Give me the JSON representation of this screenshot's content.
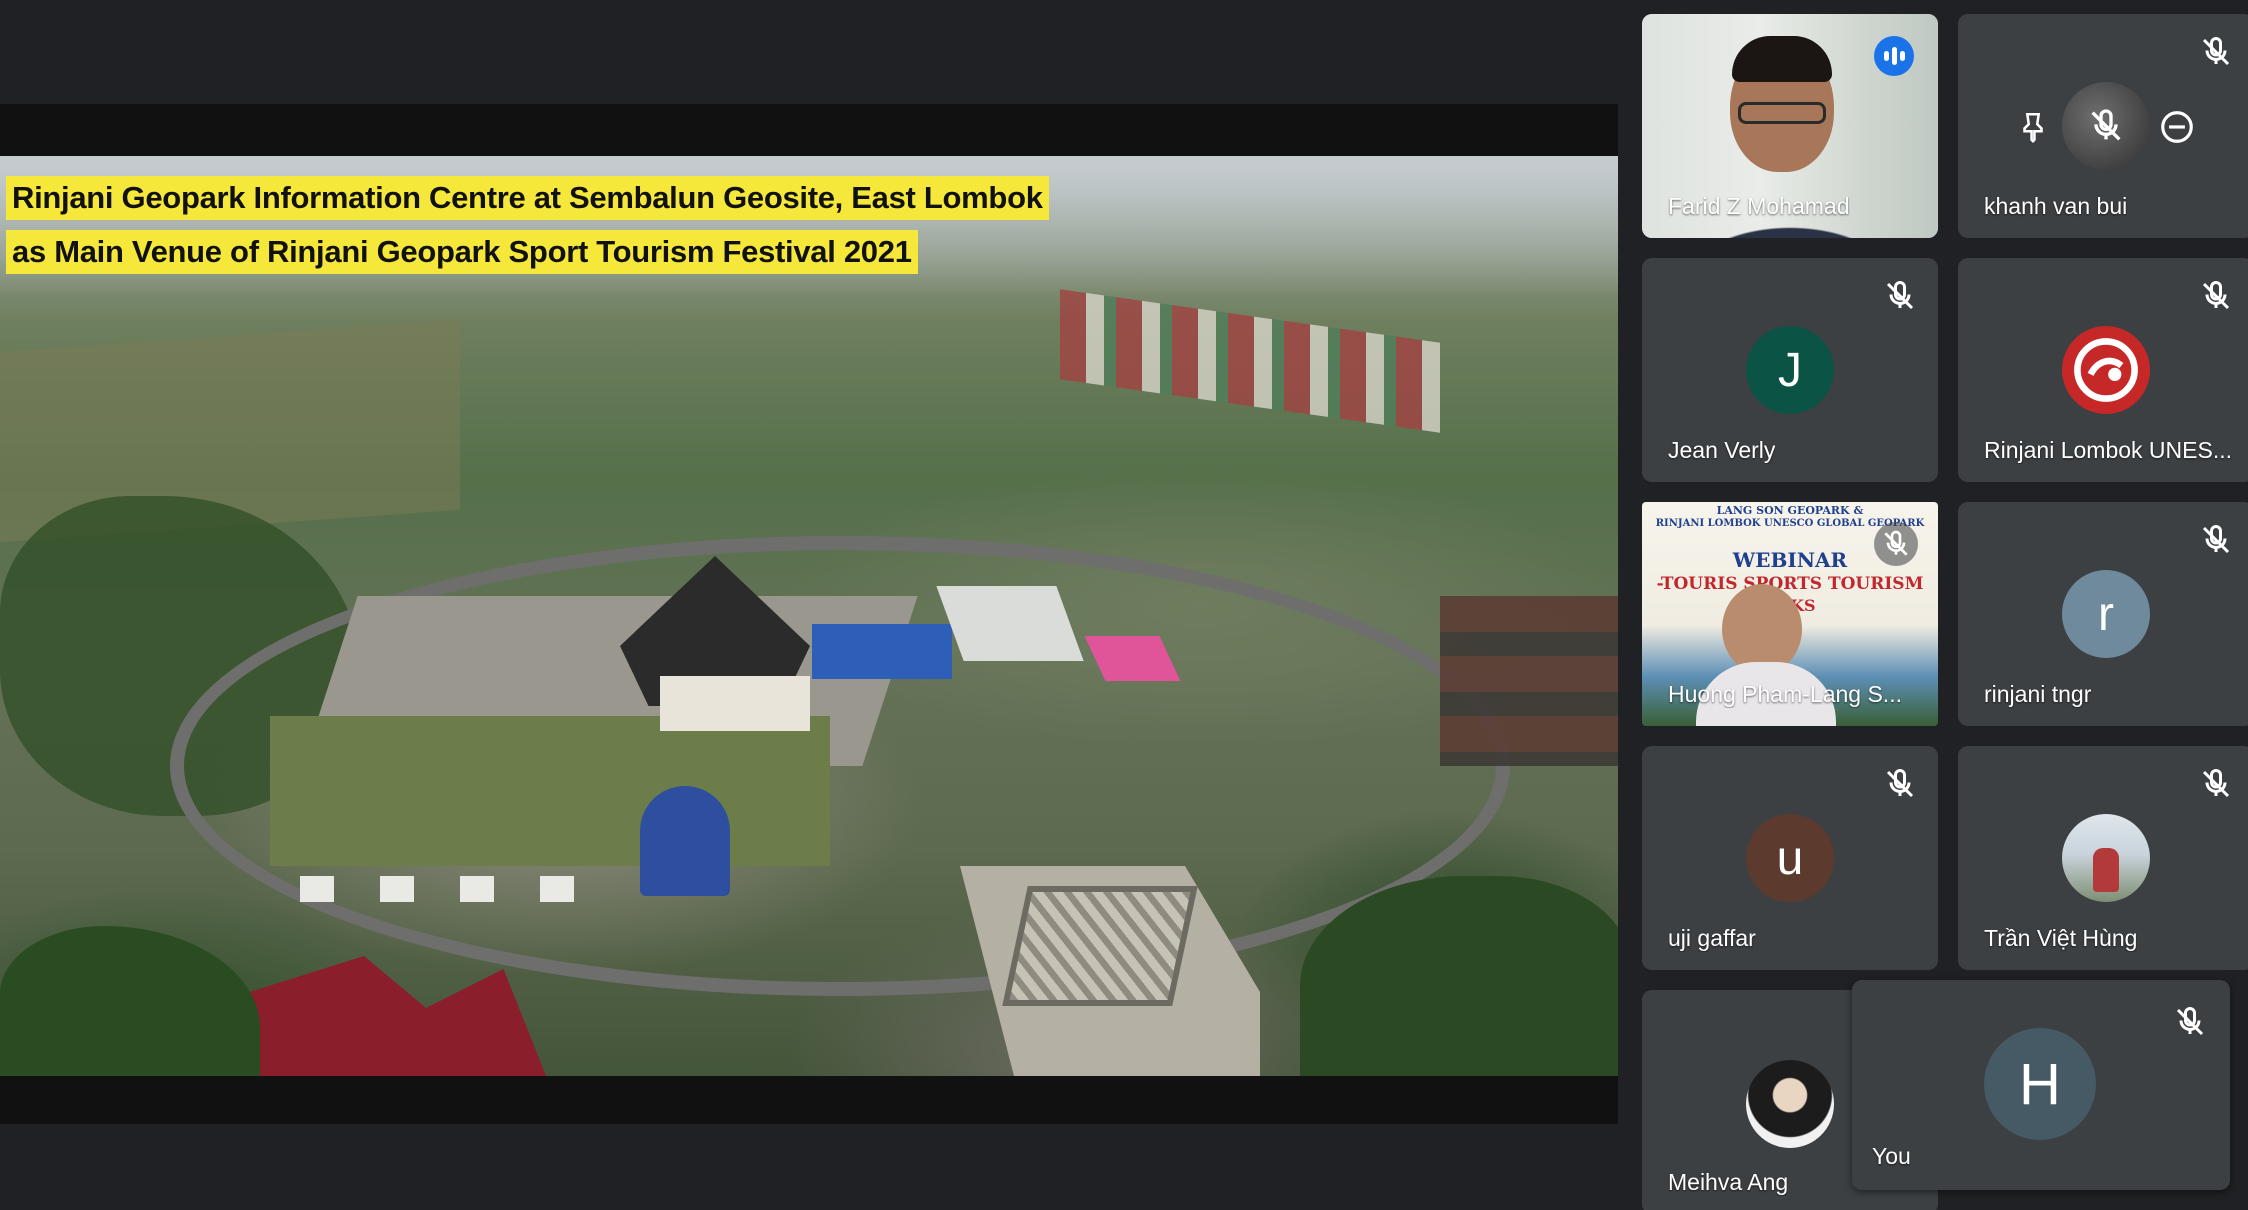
{
  "presentation": {
    "caption_line1": "Rinjani Geopark Information Centre at Sembalun Geosite, East Lombok",
    "caption_line2": "as Main Venue of Rinjani Geopark Sport Tourism Festival 2021"
  },
  "participants": [
    {
      "name": "Farid Z Mohamad",
      "type": "video",
      "speaking": true
    },
    {
      "name": "khanh van bui",
      "type": "avatar-muted-with-controls",
      "mic": "muted"
    },
    {
      "name": "Jean Verly",
      "initial": "J",
      "color": "#0b5345",
      "mic": "muted"
    },
    {
      "name": "Rinjani Lombok UNES...",
      "type": "logo",
      "color": "#c62828",
      "mic": "muted"
    },
    {
      "name": "Huong Pham-Lang S...",
      "type": "shared-video",
      "mic": "muted",
      "slide_text": {
        "line1": "LANG SON GEOPARK &",
        "line2": "RINJANI LOMBOK UNESCO GLOBAL GEOPARK",
        "line3": "WEBINAR",
        "line4": "-TOURIS      SPORTS TOURISM",
        "line5": "ARKS"
      }
    },
    {
      "name": "rinjani tngr",
      "initial": "r",
      "color": "#6f8a9c",
      "mic": "muted"
    },
    {
      "name": "uji gaffar",
      "initial": "u",
      "color": "#5d3a2e",
      "mic": "muted"
    },
    {
      "name": "Trần Việt Hùng",
      "type": "photo",
      "mic": "muted"
    },
    {
      "name": "Meihva Ang",
      "type": "photo"
    },
    {
      "name": "You",
      "initial": "H",
      "color": "#455a64",
      "mic": "muted"
    }
  ]
}
